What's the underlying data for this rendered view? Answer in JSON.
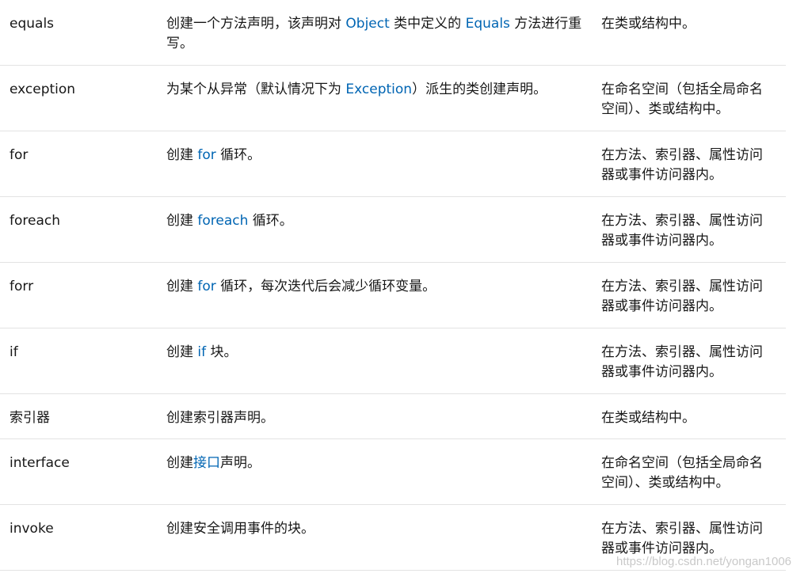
{
  "rows": [
    {
      "name": "equals",
      "desc": [
        {
          "t": "创建一个方法声明，该声明对 "
        },
        {
          "t": "Object",
          "link": true
        },
        {
          "t": " 类中定义的 "
        },
        {
          "t": "Equals",
          "link": true
        },
        {
          "t": " 方法进行重写。"
        }
      ],
      "where": "在类或结构中。"
    },
    {
      "name": "exception",
      "desc": [
        {
          "t": "为某个从异常（默认情况下为 "
        },
        {
          "t": "Exception",
          "link": true
        },
        {
          "t": "）派生的类创建声明。"
        }
      ],
      "where": "在命名空间（包括全局命名空间）、类或结构中。"
    },
    {
      "name": "for",
      "desc": [
        {
          "t": "创建 "
        },
        {
          "t": "for",
          "link": true
        },
        {
          "t": " 循环。"
        }
      ],
      "where": "在方法、索引器、属性访问器或事件访问器内。"
    },
    {
      "name": "foreach",
      "desc": [
        {
          "t": "创建 "
        },
        {
          "t": "foreach",
          "link": true
        },
        {
          "t": " 循环。"
        }
      ],
      "where": "在方法、索引器、属性访问器或事件访问器内。"
    },
    {
      "name": "forr",
      "desc": [
        {
          "t": "创建 "
        },
        {
          "t": "for",
          "link": true
        },
        {
          "t": " 循环，每次迭代后会减少循环变量。"
        }
      ],
      "where": "在方法、索引器、属性访问器或事件访问器内。"
    },
    {
      "name": "if",
      "desc": [
        {
          "t": "创建 "
        },
        {
          "t": "if",
          "link": true
        },
        {
          "t": " 块。"
        }
      ],
      "where": "在方法、索引器、属性访问器或事件访问器内。"
    },
    {
      "name": "索引器",
      "desc": [
        {
          "t": "创建索引器声明。"
        }
      ],
      "where": "在类或结构中。"
    },
    {
      "name": "interface",
      "desc": [
        {
          "t": "创建"
        },
        {
          "t": "接口",
          "link": true
        },
        {
          "t": "声明。"
        }
      ],
      "where": "在命名空间（包括全局命名空间）、类或结构中。"
    },
    {
      "name": "invoke",
      "desc": [
        {
          "t": "创建安全调用事件的块。"
        }
      ],
      "where": "在方法、索引器、属性访问器或事件访问器内。"
    }
  ],
  "watermark": "https://blog.csdn.net/yongan1006"
}
